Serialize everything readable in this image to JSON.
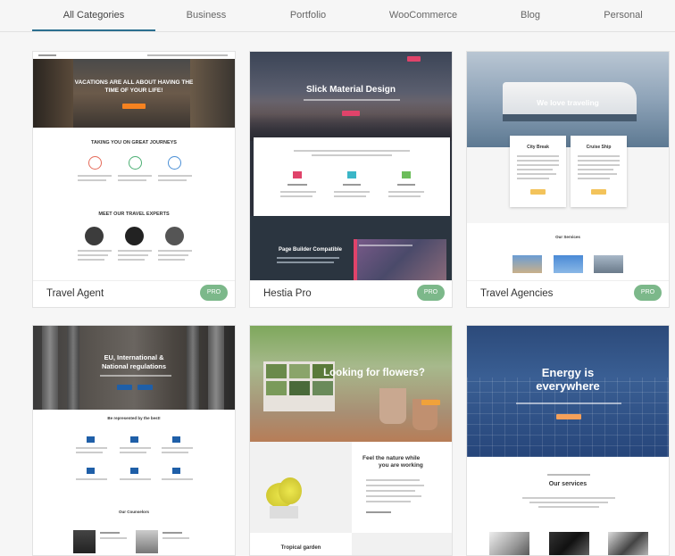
{
  "tabs": [
    {
      "label": "All Categories",
      "active": true
    },
    {
      "label": "Business",
      "active": false
    },
    {
      "label": "Portfolio",
      "active": false
    },
    {
      "label": "WooCommerce",
      "active": false
    },
    {
      "label": "Blog",
      "active": false
    },
    {
      "label": "Personal",
      "active": false
    }
  ],
  "colors": {
    "accent": "#2b6f8f",
    "pro_badge": "#7cb88a",
    "hestia_pink": "#e0436a",
    "travel_orange": "#f58220",
    "agencies_yellow": "#f3c35b",
    "gov_blue": "#1f5fa8",
    "flowers_orange": "#f0a23a",
    "energy_orange": "#f5a05a"
  },
  "cards": [
    {
      "name": "Travel Agent",
      "badge": "PRO",
      "hero": "VACATIONS ARE ALL ABOUT HAVING THE TIME OF YOUR LIFE!",
      "section1": "TAKING YOU ON GREAT JOURNEYS",
      "section2": "MEET OUR TRAVEL EXPERTS"
    },
    {
      "name": "Hestia Pro",
      "badge": "PRO",
      "hero": "Slick Material Design",
      "section1": "Page Builder Compatible"
    },
    {
      "name": "Travel Agencies",
      "badge": "PRO",
      "hero": "We love traveling",
      "box1": "City Break",
      "box2": "Cruise Ship",
      "section1": "Our Services"
    },
    {
      "hero_line1": "EU, International &",
      "hero_line2": "National regulations",
      "section1": "Be represented by the best!",
      "section2": "Our Counselors"
    },
    {
      "hero": "Looking for flowers?",
      "side_title_line1": "Feel the nature while",
      "side_title_line2": "you are working",
      "caption": "Tropical garden"
    },
    {
      "hero_line1": "Energy is",
      "hero_line2": "everywhere",
      "section1": "Our services"
    }
  ]
}
